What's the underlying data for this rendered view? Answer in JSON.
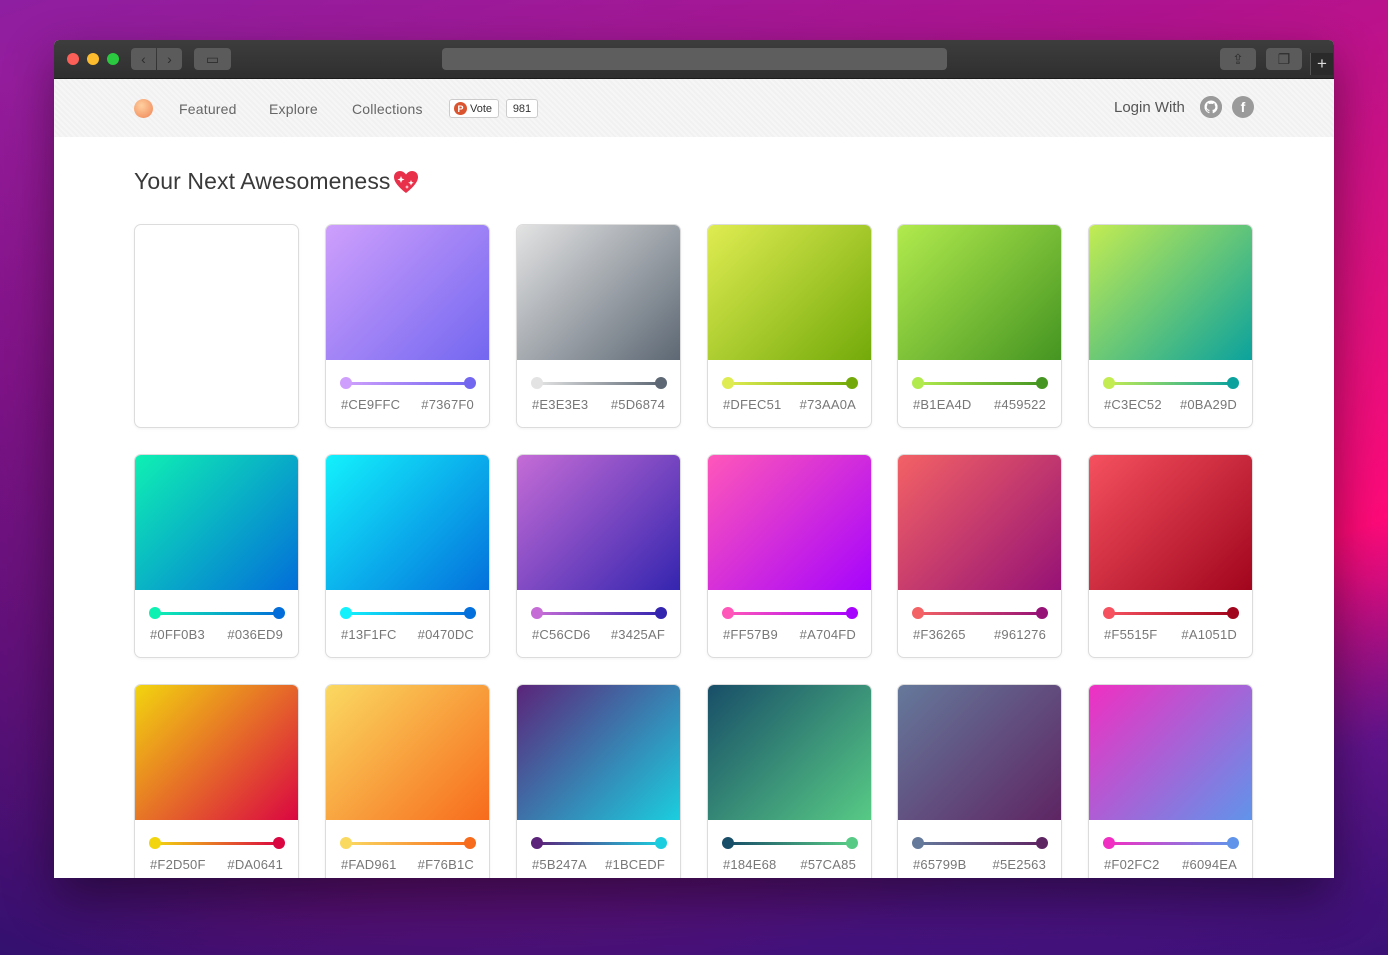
{
  "browser": {
    "back_glyph": "‹",
    "forward_glyph": "›",
    "new_tab_glyph": "+",
    "sidebar_glyph": "▭",
    "share_glyph": "⇪",
    "tabs_glyph": "❐"
  },
  "nav": {
    "links": [
      "Featured",
      "Explore",
      "Collections"
    ],
    "vote_p": "P",
    "vote_label": "Vote",
    "vote_count": "981",
    "login_label": "Login With",
    "facebook_glyph": "f",
    "github_glyph": "●"
  },
  "heading": "Your Next Awesomeness",
  "cards": [
    {
      "a": "",
      "b": ""
    },
    {
      "a": "#CE9FFC",
      "b": "#7367F0"
    },
    {
      "a": "#E3E3E3",
      "b": "#5D6874"
    },
    {
      "a": "#DFEC51",
      "b": "#73AA0A"
    },
    {
      "a": "#B1EA4D",
      "b": "#459522"
    },
    {
      "a": "#C3EC52",
      "b": "#0BA29D"
    },
    {
      "a": "#0FF0B3",
      "b": "#036ED9"
    },
    {
      "a": "#13F1FC",
      "b": "#0470DC"
    },
    {
      "a": "#C56CD6",
      "b": "#3425AF"
    },
    {
      "a": "#FF57B9",
      "b": "#A704FD"
    },
    {
      "a": "#F36265",
      "b": "#961276"
    },
    {
      "a": "#F5515F",
      "b": "#A1051D"
    },
    {
      "a": "#F2D50F",
      "b": "#DA0641"
    },
    {
      "a": "#FAD961",
      "b": "#F76B1C"
    },
    {
      "a": "#5B247A",
      "b": "#1BCEDF"
    },
    {
      "a": "#184E68",
      "b": "#57CA85"
    },
    {
      "a": "#65799B",
      "b": "#5E2563"
    },
    {
      "a": "#F02FC2",
      "b": "#6094EA"
    }
  ]
}
